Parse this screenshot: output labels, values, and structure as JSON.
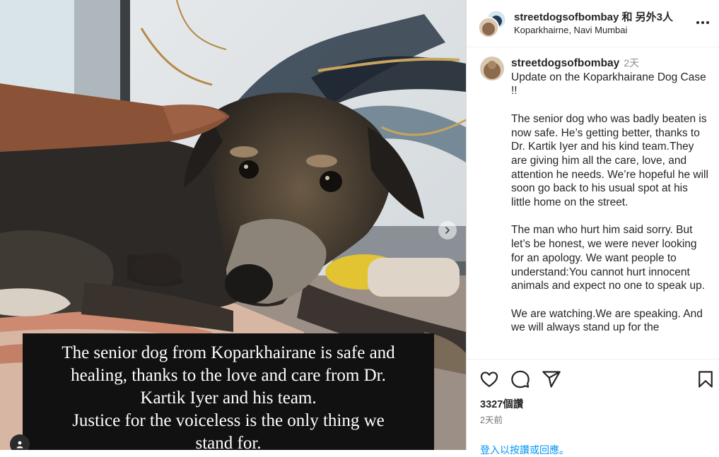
{
  "post_image": {
    "caption_lines": [
      "The senior dog from Koparkhairane is safe and",
      "healing, thanks to the love and care from Dr.",
      "Kartik Iyer and his team.",
      "Justice for the voiceless is the only thing we",
      "stand for."
    ]
  },
  "header": {
    "title": "streetdogsofbombay 和 另外3人",
    "location": "Koparkhairne, Navi Mumbai"
  },
  "comment": {
    "username": "streetdogsofbombay",
    "time": "2天",
    "paragraphs": [
      "Update on the Koparkhairane Dog Case !!",
      "The senior dog who was badly beaten is now safe. He’s getting better, thanks to Dr. Kartik Iyer and his kind team.They are giving him all the care, love, and attention he needs. We’re hopeful he will soon go back to his usual spot at his little home on the street.",
      "The man who hurt him said sorry. But let’s be honest, we were never looking for an apology. We want people to understand:You cannot hurt innocent animals and expect no one to speak up.",
      "We are watching.We are speaking. And we will always stand up for the"
    ]
  },
  "footer": {
    "likes": "3327個讚",
    "posted": "2天前",
    "login_prompt": "登入以按讚或回應。"
  },
  "icons": {
    "like": "heart-icon",
    "comment": "comment-icon",
    "share": "share-icon",
    "save": "bookmark-icon",
    "more": "more-icon",
    "next": "chevron-right-icon",
    "tagged": "user-icon"
  }
}
